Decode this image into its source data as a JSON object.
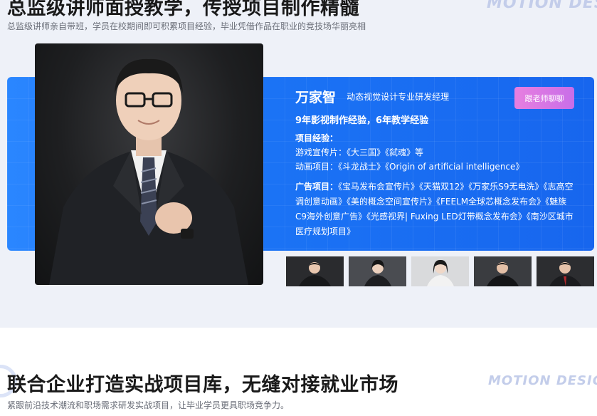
{
  "section1": {
    "title": "总监级讲师面授教学，传授项目制作精髓",
    "subtitle": "总监级讲师亲自带班，学员在校期间即可积累项目经验，毕业凭借作品在职业的竞技场华丽亮相",
    "watermark": "MOTION DESIGN"
  },
  "teacher": {
    "name": "万家智",
    "title": "动态视觉设计专业研发经理",
    "experience": "9年影视制作经验，6年教学经验",
    "project_label": "项目经验：",
    "game_line": "游戏宣传片：《大三国》《弑魂》等",
    "anim_line": "动画项目：《斗龙战士》《Origin of artificial intelligence》",
    "ad_label": "广告项目：",
    "ad_projects": "《宝马发布会宣传片》《天猫双12》《万家乐S9无电洗》《志高空调创意动画》《美的概念空间宣传片》《FEELM全球芯概念发布会》《魅族C9海外创意广告》《光感视界| Fuxing LED灯带概念发布会》《南沙区城市医疗规划项目》",
    "chat_button": "跟老师聊聊"
  },
  "section2": {
    "title": "联合企业打造实战项目库，无缝对接就业市场",
    "subtitle": "紧跟前沿技术潮流和职场需求研发实战项目，让毕业学员更具职场竞争力。",
    "watermark": "MOTION DESIGN"
  },
  "colors": {
    "card_blue": "#1b73f5",
    "button_pink": "#d875e6",
    "watermark": "#c3cdea"
  }
}
